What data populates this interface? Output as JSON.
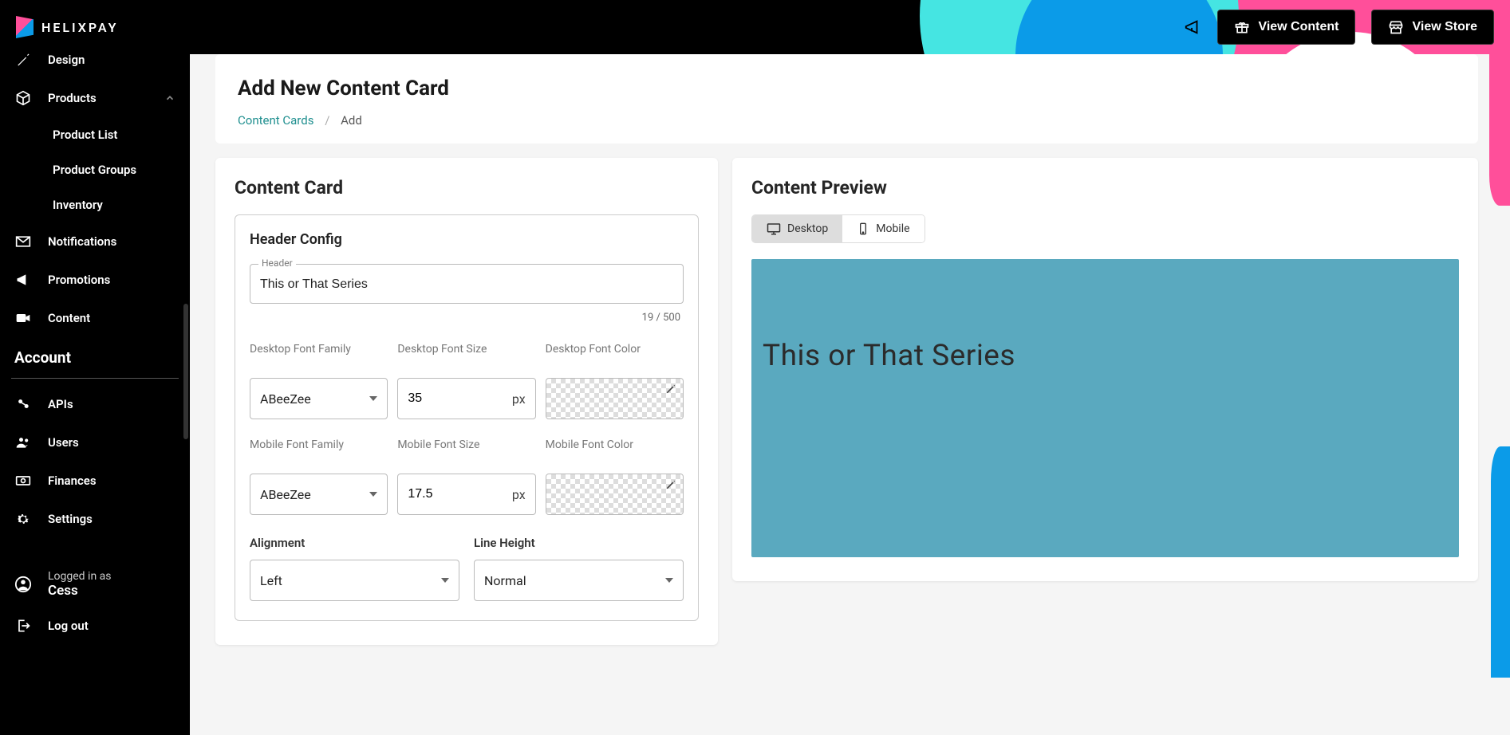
{
  "brand": "HELIXPAY",
  "header": {
    "view_content": "View Content",
    "view_store": "View Store"
  },
  "sidebar": {
    "items": {
      "design": "Design",
      "products": "Products",
      "product_list": "Product List",
      "product_groups": "Product Groups",
      "inventory": "Inventory",
      "notifications": "Notifications",
      "promotions": "Promotions",
      "content": "Content"
    },
    "section_account": "Account",
    "apis": "APIs",
    "users": "Users",
    "finances": "Finances",
    "settings": "Settings",
    "logged_in_label": "Logged in as",
    "logged_in_name": "Cess",
    "logout": "Log out"
  },
  "page": {
    "title": "Add New Content Card",
    "bc_parent": "Content Cards",
    "bc_current": "Add"
  },
  "form": {
    "panel_title": "Content Card",
    "section_title": "Header Config",
    "header_label": "Header",
    "header_value": "This or That Series",
    "char_count": "19 / 500",
    "desktop_font_family_label": "Desktop Font Family",
    "desktop_font_family_value": "ABeeZee",
    "desktop_font_size_label": "Desktop Font Size",
    "desktop_font_size_value": "35",
    "desktop_font_color_label": "Desktop Font Color",
    "mobile_font_family_label": "Mobile Font Family",
    "mobile_font_family_value": "ABeeZee",
    "mobile_font_size_label": "Mobile Font Size",
    "mobile_font_size_value": "17.5",
    "mobile_font_color_label": "Mobile Font Color",
    "px_suffix": "px",
    "alignment_label": "Alignment",
    "alignment_value": "Left",
    "line_height_label": "Line Height",
    "line_height_value": "Normal"
  },
  "preview": {
    "panel_title": "Content Preview",
    "desktop": "Desktop",
    "mobile": "Mobile",
    "header_text": "This or That Series"
  }
}
